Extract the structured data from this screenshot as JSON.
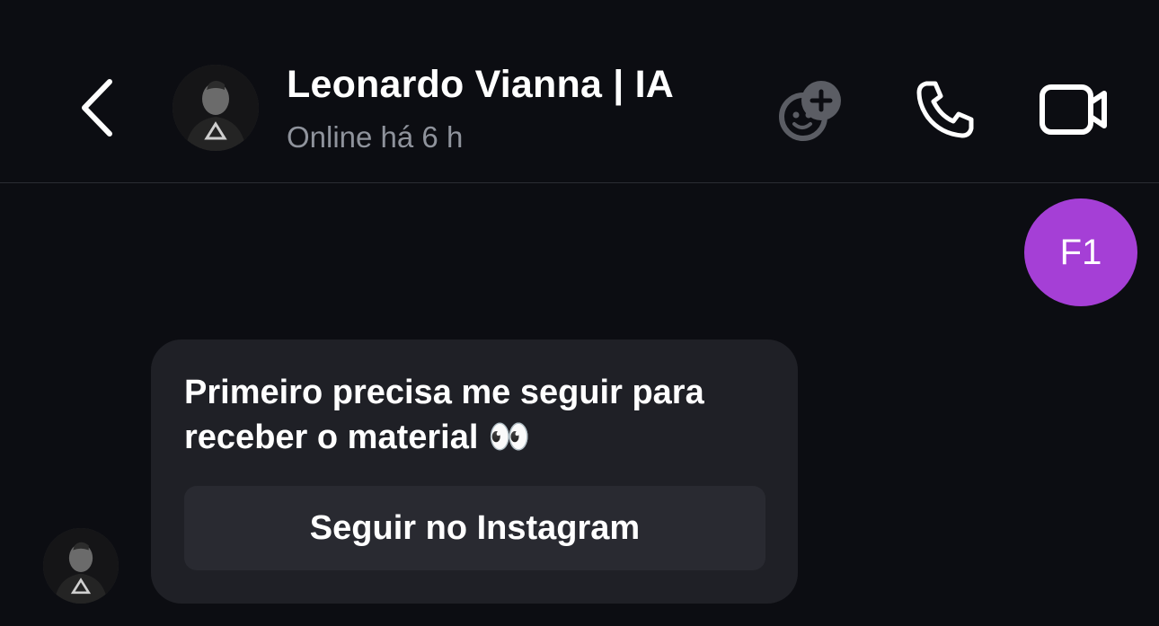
{
  "header": {
    "contact_name": "Leonardo Vianna | IA",
    "status": "Online há 6 h",
    "back_icon": "chevron-left-icon",
    "add_people_icon": "avatars-add-icon",
    "call_icon": "phone-icon",
    "video_icon": "video-camera-icon"
  },
  "messages": {
    "sender_badge": "F1",
    "sender_badge_color": "#a53fd6",
    "incoming_text": "Primeiro precisa me seguir para receber o material 👀",
    "follow_button_label": "Seguir no Instagram"
  },
  "colors": {
    "background": "#0c0d12",
    "bubble": "#1f2026",
    "button": "#292a31",
    "muted_text": "#8f939c"
  }
}
